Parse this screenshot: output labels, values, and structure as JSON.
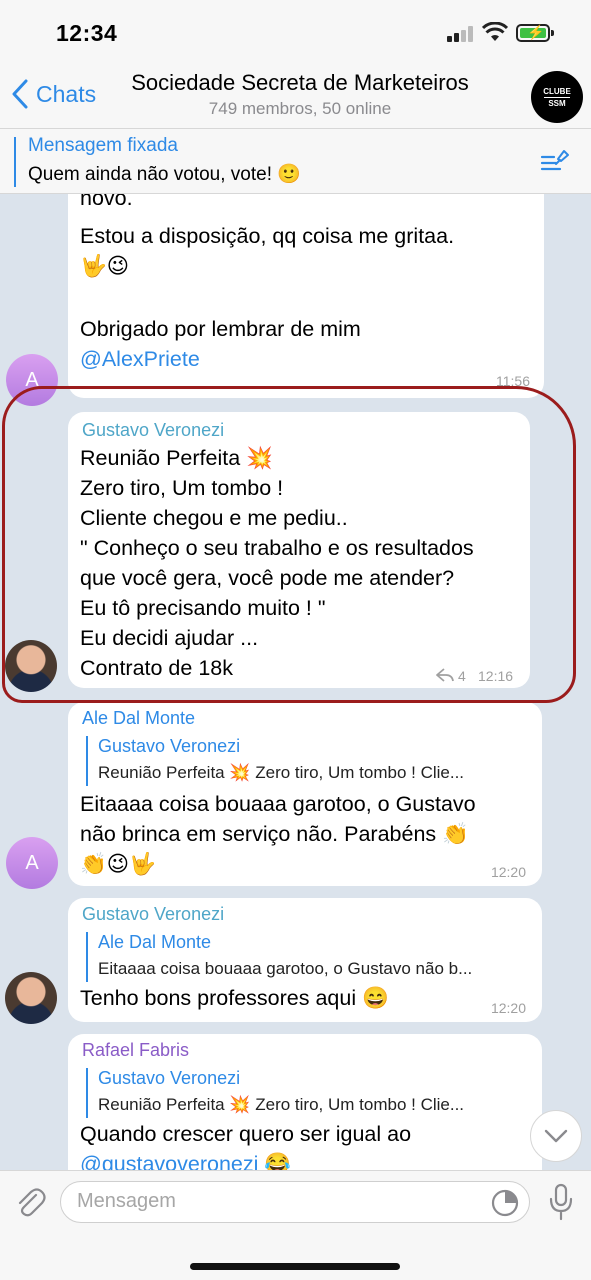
{
  "status": {
    "time": "12:34"
  },
  "header": {
    "back_label": "Chats",
    "title": "Sociedade Secreta de Marketeiros",
    "subtitle": "749 membros, 50 online",
    "avatar_line1": "CLUBE",
    "avatar_line2": "SSM"
  },
  "pinned": {
    "title": "Mensagem fixada",
    "text": "Quem ainda não votou, vote! 🙂"
  },
  "messages": [
    {
      "lines": [
        "novo.",
        "Estou a disposição, qq coisa me gritaa.",
        "🤟😉",
        "Obrigado por lembrar de mim",
        "@AlexPriete"
      ],
      "time": "11:56",
      "avatar_letter": "A"
    },
    {
      "sender": "Gustavo Veronezi",
      "lines": [
        "Reunião Perfeita 💥",
        "Zero tiro, Um tombo !",
        "Cliente chegou e me pediu..",
        "\" Conheço o seu trabalho e os resultados",
        "que você gera, você pode me atender?",
        "Eu tô precisando muito ! \"",
        "Eu decidi ajudar ...",
        "Contrato de 18k"
      ],
      "forwards": "4",
      "time": "12:16"
    },
    {
      "sender": "Ale Dal Monte",
      "reply_name": "Gustavo Veronezi",
      "reply_text": "Reunião Perfeita 💥 Zero tiro, Um tombo ! Clie...",
      "lines": [
        "Eitaaaa coisa bouaaa garotoo, o Gustavo",
        "não brinca em serviço não. Parabéns 👏",
        "👏😉🤟"
      ],
      "time": "12:20",
      "avatar_letter": "A"
    },
    {
      "sender": "Gustavo Veronezi",
      "reply_name": "Ale Dal Monte",
      "reply_text": "Eitaaaa coisa bouaaa garotoo, o Gustavo não b...",
      "lines": [
        "Tenho bons professores aqui 😄"
      ],
      "time": "12:20"
    },
    {
      "sender": "Rafael Fabris",
      "reply_name": "Gustavo Veronezi",
      "reply_text": "Reunião Perfeita 💥 Zero tiro, Um tombo ! Clie...",
      "lines": [
        "Quando crescer quero ser igual ao",
        "@gustavoveronezi 😂"
      ]
    }
  ],
  "input": {
    "placeholder": "Mensagem"
  },
  "colors": {
    "accent": "#2e8ae6",
    "highlight": "#9b1c1c",
    "sender_gustavo": "#4fa6c8",
    "sender_ale": "#2e8ae6",
    "sender_rafael": "#8a5cc7"
  }
}
